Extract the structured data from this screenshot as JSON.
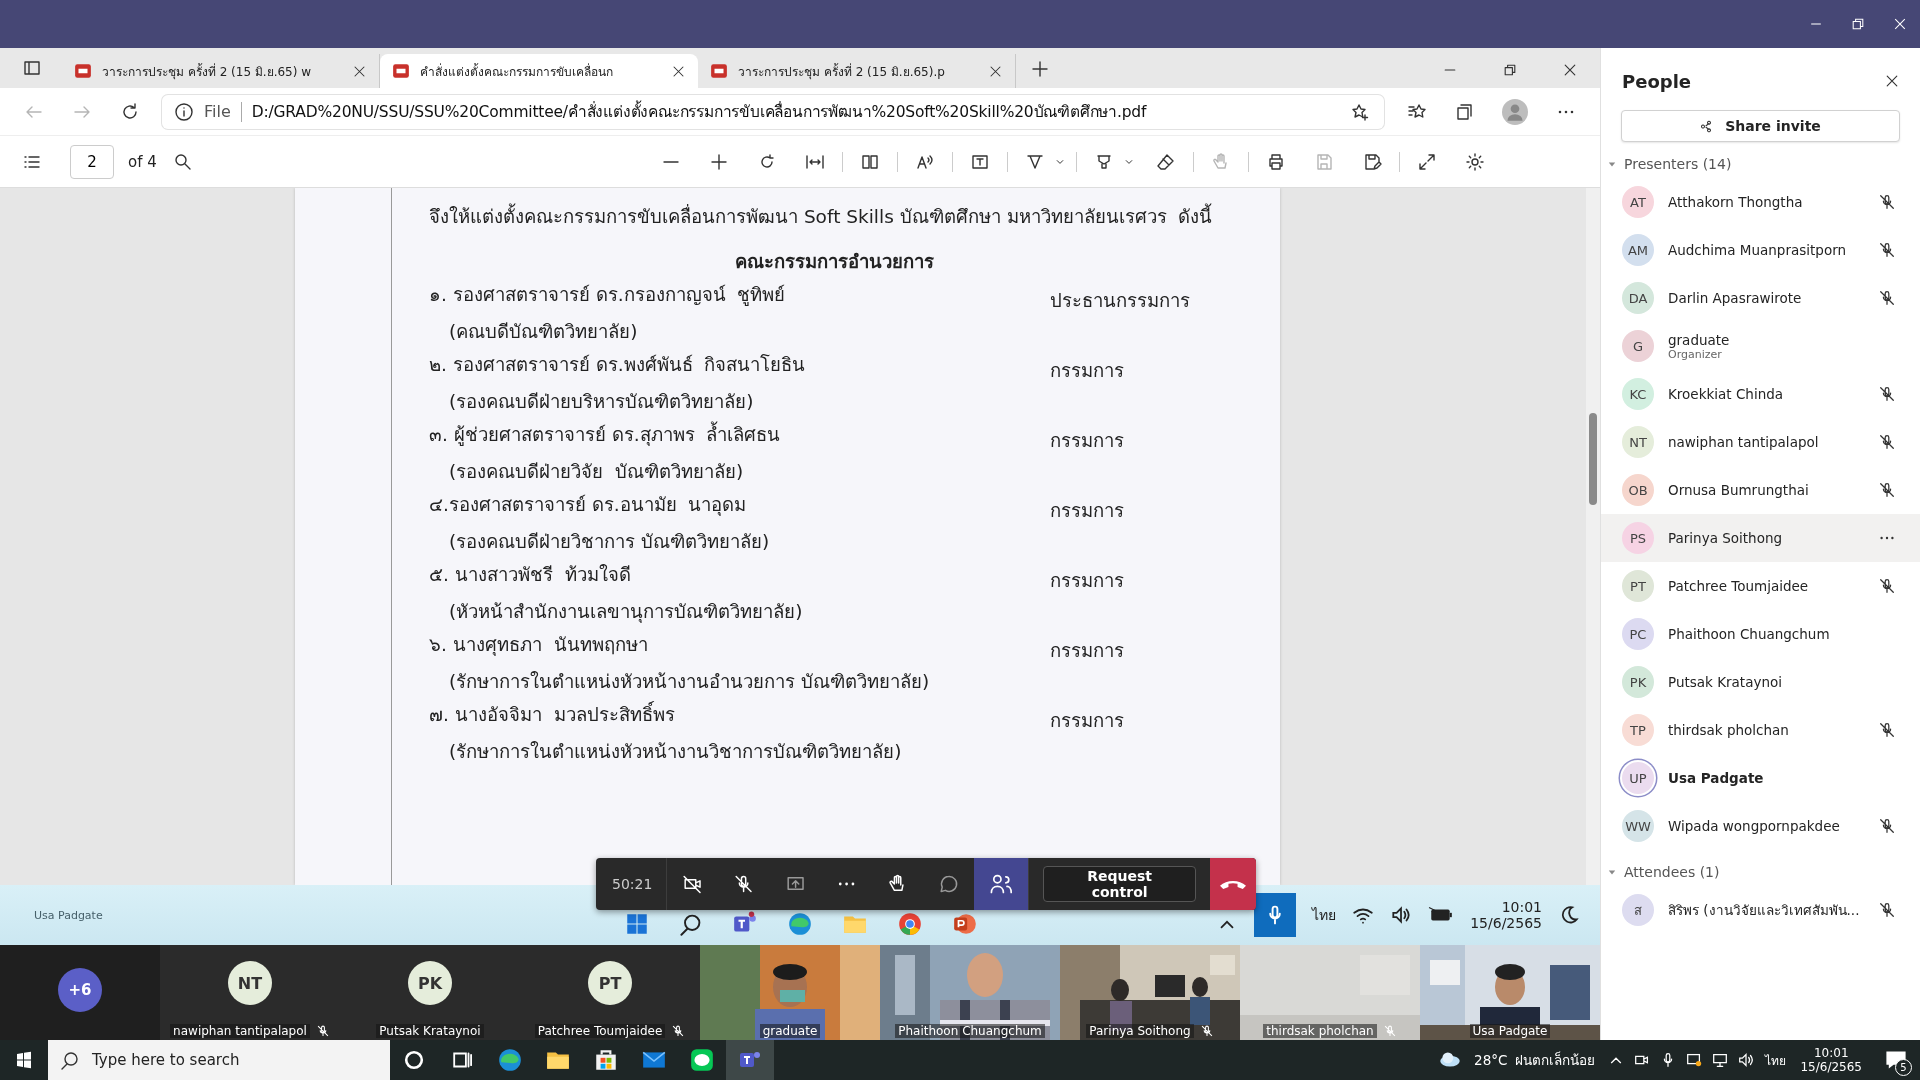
{
  "browser": {
    "tabs": [
      {
        "label": "วาระการประชุม ครั้งที่ 2 (15 มิ.ย.65) w",
        "selected": false
      },
      {
        "label": "คำสั่งแต่งตั้งคณะกรรมการขับเคลื่อนก",
        "selected": true
      },
      {
        "label": "วาระการประชุม ครั้งที่ 2 (15 มิ.ย.65).p",
        "selected": false
      }
    ],
    "address": {
      "scheme": "File",
      "url": "D:/GRAD%20NU/SSU/SSU%20Committee/คำสั่งแต่งตั้งคณะกรรมการขับเคลื่อนการพัฒนา%20Soft%20Skill%20บัณฑิตศึกษา.pdf"
    },
    "pdf_toolbar": {
      "page": "2",
      "page_count": "of 4"
    }
  },
  "document": {
    "intro": "จึงให้แต่งตั้งคณะกรรมการขับเคลื่อนการพัฒนา Soft Skills บัณฑิตศึกษา มหาวิทยาลัยนเรศวร  ดังนี้",
    "heading": "คณะกรรมการอำนวยการ",
    "members": [
      {
        "name": "๑. รองศาสตราจารย์ ดร.กรองกาญจน์  ชูทิพย์",
        "position": "(คณบดีบัณฑิตวิทยาลัย)",
        "role": "ประธานกรรมการ"
      },
      {
        "name": "๒. รองศาสตราจารย์ ดร.พงศ์พันธ์  กิจสนาโยธิน",
        "position": "(รองคณบดีฝ่ายบริหารบัณฑิตวิทยาลัย)",
        "role": "กรรมการ"
      },
      {
        "name": "๓. ผู้ช่วยศาสตราจารย์ ดร.สุภาพร  ล้ำเลิศธน",
        "position": "(รองคณบดีฝ่ายวิจัย  บัณฑิตวิทยาลัย)",
        "role": "กรรมการ"
      },
      {
        "name": "๔.รองศาสตราจารย์ ดร.อนามัย  นาอุดม",
        "position": "(รองคณบดีฝ่ายวิชาการ บัณฑิตวิทยาลัย)",
        "role": "กรรมการ"
      },
      {
        "name": "๕. นางสาวพัชรี  ท้วมใจดี",
        "position": "(หัวหน้าสำนักงานเลขานุการบัณฑิตวิทยาลัย)",
        "role": "กรรมการ"
      },
      {
        "name": "๖. นางศุทธภา  นันทพฤกษา",
        "position": "(รักษาการในตำแหน่งหัวหน้างานอำนวยการ บัณฑิตวิทยาลัย)",
        "role": "กรรมการ"
      },
      {
        "name": "๗. นางอัจจิมา  มวลประสิทธิ์พร",
        "position": "(รักษาการในตำแหน่งหัวหน้างานวิชาการบัณฑิตวิทยาลัย)",
        "role": "กรรมการ"
      }
    ]
  },
  "shared_taskbar": {
    "user_label": "Usa Padgate",
    "language": "ไทย",
    "time": "10:01",
    "date": "15/6/2565"
  },
  "meeting_controls": {
    "timer": "50:21",
    "people_open": true,
    "request_control": "Request control"
  },
  "video_strip": {
    "overflow": "+6",
    "tiles": [
      {
        "kind": "avatar",
        "initials": "NT",
        "name": "nawiphan tantipalapol",
        "muted": true
      },
      {
        "kind": "avatar",
        "initials": "PK",
        "name": "Putsak Krataynoi",
        "muted": false
      },
      {
        "kind": "avatar",
        "initials": "PT",
        "name": "Patchree Toumjaidee",
        "muted": true
      },
      {
        "kind": "picture",
        "name": "graduate",
        "muted": false
      },
      {
        "kind": "picture",
        "name": "Phaithoon Chuangchum",
        "muted": false
      },
      {
        "kind": "picture",
        "name": "Parinya Soithong",
        "muted": true
      },
      {
        "kind": "picture",
        "name": "thirdsak pholchan",
        "muted": true
      },
      {
        "kind": "picture",
        "name": "Usa Padgate",
        "muted": false
      }
    ]
  },
  "people": {
    "title": "People",
    "share_invite": "Share invite",
    "groups": [
      {
        "label": "Presenters (14)",
        "expanded": true,
        "members": [
          {
            "initials": "AT",
            "name": "Atthakorn Thongtha",
            "color": "#f7d6dd",
            "muted": true,
            "hovered": false,
            "current_user": false
          },
          {
            "initials": "AM",
            "name": "Audchima Muanprasitporn",
            "color": "#d3dfee",
            "muted": true,
            "hovered": false,
            "current_user": false
          },
          {
            "initials": "DA",
            "name": "Darlin Apasrawirote",
            "color": "#d4e7dc",
            "muted": true,
            "hovered": false,
            "current_user": false
          },
          {
            "initials": "G",
            "name": "graduate",
            "subtitle": "Organizer",
            "color": "#ecd2d7",
            "muted": false,
            "hovered": false,
            "current_user": false
          },
          {
            "initials": "KC",
            "name": "Kroekkiat Chinda",
            "color": "#d2efe0",
            "muted": true,
            "hovered": false,
            "current_user": false
          },
          {
            "initials": "NT",
            "name": "nawiphan tantipalapol",
            "color": "#e5eddb",
            "muted": true,
            "hovered": false,
            "current_user": false
          },
          {
            "initials": "OB",
            "name": "Ornusa Bumrungthai",
            "color": "#f6d6cd",
            "muted": true,
            "hovered": false,
            "current_user": false
          },
          {
            "initials": "PS",
            "name": "Parinya Soithong",
            "color": "#f6d3e4",
            "hovered": true,
            "current_user": false
          },
          {
            "initials": "PT",
            "name": "Patchree Toumjaidee",
            "color": "#dfe6d8",
            "muted": true,
            "hovered": false,
            "current_user": false
          },
          {
            "initials": "PC",
            "name": "Phaithoon Chuangchum",
            "color": "#dcdaf1",
            "muted": false,
            "hovered": false,
            "current_user": false
          },
          {
            "initials": "PK",
            "name": "Putsak Krataynoi",
            "color": "#d3e8da",
            "muted": false,
            "hovered": false,
            "current_user": false
          },
          {
            "initials": "TP",
            "name": "thirdsak pholchan",
            "color": "#f8dcd5",
            "muted": true,
            "hovered": false,
            "current_user": false
          },
          {
            "initials": "UP",
            "name": "Usa Padgate",
            "color": "#ebdcef",
            "muted": false,
            "hovered": false,
            "current_user": true
          },
          {
            "initials": "WW",
            "name": "Wipada wongpornpakdee",
            "color": "#d5e4e8",
            "muted": true,
            "hovered": false,
            "current_user": false
          }
        ]
      },
      {
        "label": "Attendees (1)",
        "expanded": true,
        "members": [
          {
            "initials": "ส",
            "name": "สิริพร (งานวิจัยและวิเทศสัมพัน...",
            "color": "#dddcf0",
            "muted": true,
            "hovered": false,
            "current_user": false
          }
        ]
      }
    ]
  },
  "windows_taskbar": {
    "search_placeholder": "Type here to search",
    "temperature": "28°C",
    "weather": "ฝนตกเล็กน้อย",
    "language": "ไทย",
    "time": "10:01",
    "date": "15/6/2565",
    "notifications": "5"
  }
}
